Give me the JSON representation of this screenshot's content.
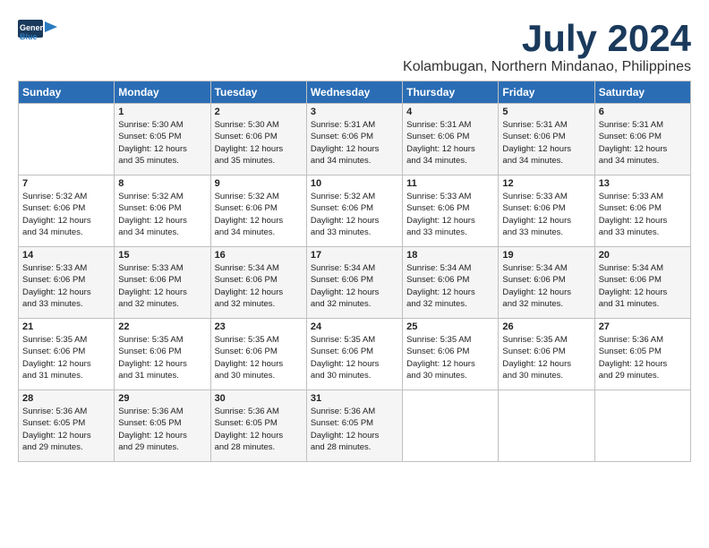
{
  "logo": {
    "line1": "General",
    "line2": "Blue"
  },
  "title": "July 2024",
  "subtitle": "Kolambugan, Northern Mindanao, Philippines",
  "days_header": [
    "Sunday",
    "Monday",
    "Tuesday",
    "Wednesday",
    "Thursday",
    "Friday",
    "Saturday"
  ],
  "weeks": [
    [
      {
        "day": "",
        "text": ""
      },
      {
        "day": "1",
        "text": "Sunrise: 5:30 AM\nSunset: 6:05 PM\nDaylight: 12 hours\nand 35 minutes."
      },
      {
        "day": "2",
        "text": "Sunrise: 5:30 AM\nSunset: 6:06 PM\nDaylight: 12 hours\nand 35 minutes."
      },
      {
        "day": "3",
        "text": "Sunrise: 5:31 AM\nSunset: 6:06 PM\nDaylight: 12 hours\nand 34 minutes."
      },
      {
        "day": "4",
        "text": "Sunrise: 5:31 AM\nSunset: 6:06 PM\nDaylight: 12 hours\nand 34 minutes."
      },
      {
        "day": "5",
        "text": "Sunrise: 5:31 AM\nSunset: 6:06 PM\nDaylight: 12 hours\nand 34 minutes."
      },
      {
        "day": "6",
        "text": "Sunrise: 5:31 AM\nSunset: 6:06 PM\nDaylight: 12 hours\nand 34 minutes."
      }
    ],
    [
      {
        "day": "7",
        "text": "Sunrise: 5:32 AM\nSunset: 6:06 PM\nDaylight: 12 hours\nand 34 minutes."
      },
      {
        "day": "8",
        "text": "Sunrise: 5:32 AM\nSunset: 6:06 PM\nDaylight: 12 hours\nand 34 minutes."
      },
      {
        "day": "9",
        "text": "Sunrise: 5:32 AM\nSunset: 6:06 PM\nDaylight: 12 hours\nand 34 minutes."
      },
      {
        "day": "10",
        "text": "Sunrise: 5:32 AM\nSunset: 6:06 PM\nDaylight: 12 hours\nand 33 minutes."
      },
      {
        "day": "11",
        "text": "Sunrise: 5:33 AM\nSunset: 6:06 PM\nDaylight: 12 hours\nand 33 minutes."
      },
      {
        "day": "12",
        "text": "Sunrise: 5:33 AM\nSunset: 6:06 PM\nDaylight: 12 hours\nand 33 minutes."
      },
      {
        "day": "13",
        "text": "Sunrise: 5:33 AM\nSunset: 6:06 PM\nDaylight: 12 hours\nand 33 minutes."
      }
    ],
    [
      {
        "day": "14",
        "text": "Sunrise: 5:33 AM\nSunset: 6:06 PM\nDaylight: 12 hours\nand 33 minutes."
      },
      {
        "day": "15",
        "text": "Sunrise: 5:33 AM\nSunset: 6:06 PM\nDaylight: 12 hours\nand 32 minutes."
      },
      {
        "day": "16",
        "text": "Sunrise: 5:34 AM\nSunset: 6:06 PM\nDaylight: 12 hours\nand 32 minutes."
      },
      {
        "day": "17",
        "text": "Sunrise: 5:34 AM\nSunset: 6:06 PM\nDaylight: 12 hours\nand 32 minutes."
      },
      {
        "day": "18",
        "text": "Sunrise: 5:34 AM\nSunset: 6:06 PM\nDaylight: 12 hours\nand 32 minutes."
      },
      {
        "day": "19",
        "text": "Sunrise: 5:34 AM\nSunset: 6:06 PM\nDaylight: 12 hours\nand 32 minutes."
      },
      {
        "day": "20",
        "text": "Sunrise: 5:34 AM\nSunset: 6:06 PM\nDaylight: 12 hours\nand 31 minutes."
      }
    ],
    [
      {
        "day": "21",
        "text": "Sunrise: 5:35 AM\nSunset: 6:06 PM\nDaylight: 12 hours\nand 31 minutes."
      },
      {
        "day": "22",
        "text": "Sunrise: 5:35 AM\nSunset: 6:06 PM\nDaylight: 12 hours\nand 31 minutes."
      },
      {
        "day": "23",
        "text": "Sunrise: 5:35 AM\nSunset: 6:06 PM\nDaylight: 12 hours\nand 30 minutes."
      },
      {
        "day": "24",
        "text": "Sunrise: 5:35 AM\nSunset: 6:06 PM\nDaylight: 12 hours\nand 30 minutes."
      },
      {
        "day": "25",
        "text": "Sunrise: 5:35 AM\nSunset: 6:06 PM\nDaylight: 12 hours\nand 30 minutes."
      },
      {
        "day": "26",
        "text": "Sunrise: 5:35 AM\nSunset: 6:06 PM\nDaylight: 12 hours\nand 30 minutes."
      },
      {
        "day": "27",
        "text": "Sunrise: 5:36 AM\nSunset: 6:05 PM\nDaylight: 12 hours\nand 29 minutes."
      }
    ],
    [
      {
        "day": "28",
        "text": "Sunrise: 5:36 AM\nSunset: 6:05 PM\nDaylight: 12 hours\nand 29 minutes."
      },
      {
        "day": "29",
        "text": "Sunrise: 5:36 AM\nSunset: 6:05 PM\nDaylight: 12 hours\nand 29 minutes."
      },
      {
        "day": "30",
        "text": "Sunrise: 5:36 AM\nSunset: 6:05 PM\nDaylight: 12 hours\nand 28 minutes."
      },
      {
        "day": "31",
        "text": "Sunrise: 5:36 AM\nSunset: 6:05 PM\nDaylight: 12 hours\nand 28 minutes."
      },
      {
        "day": "",
        "text": ""
      },
      {
        "day": "",
        "text": ""
      },
      {
        "day": "",
        "text": ""
      }
    ]
  ]
}
